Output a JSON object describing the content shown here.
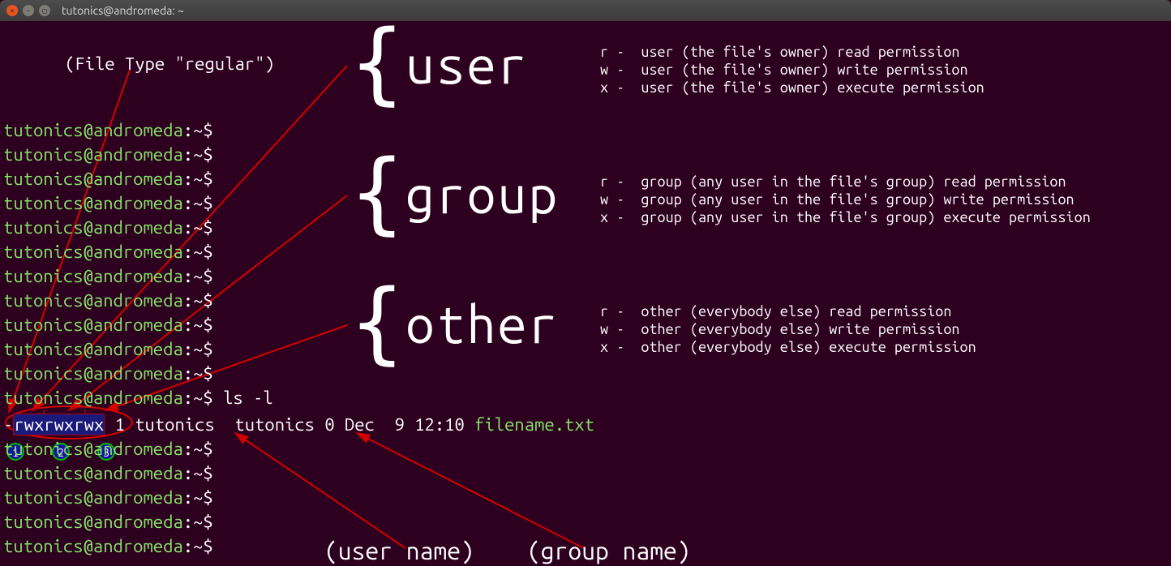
{
  "title": "tutonics@andromeda: ~",
  "prompt": {
    "user_host": "tutonics@andromeda",
    "sep": ":",
    "path": "~",
    "dollar": "$"
  },
  "command": "ls -l",
  "file_type_note": "(File Type \"regular\")",
  "ls": {
    "mode_dash": "-",
    "rwx1": "rwx",
    "rwx2": "rwx",
    "rwx3": "rwx",
    "links": "1",
    "user": "tutonics",
    "group": "tutonics",
    "size": "0",
    "date": "Dec  9 12:10",
    "filename": "filename.txt"
  },
  "big": {
    "user": "user",
    "group": "group",
    "other": "other"
  },
  "legend": {
    "user": {
      "r": "r -  user (the file's owner) read permission",
      "w": "w -  user (the file's owner) write permission",
      "x": "x -  user (the file's owner) execute permission"
    },
    "group": {
      "r": "r -  group (any user in the file's group) read permission",
      "w": "w -  group (any user in the file's group) write permission",
      "x": "x -  group (any user in the file's group) execute permission"
    },
    "other": {
      "r": "r -  other (everybody else) read permission",
      "w": "w -  other (everybody else) write permission",
      "x": "x -  other (everybody else) execute permission"
    }
  },
  "bottom_labels": {
    "user_name": "(user name)",
    "group_name": "(group name)"
  },
  "circles": {
    "n1": "1",
    "n2": "2",
    "n3": "3"
  }
}
